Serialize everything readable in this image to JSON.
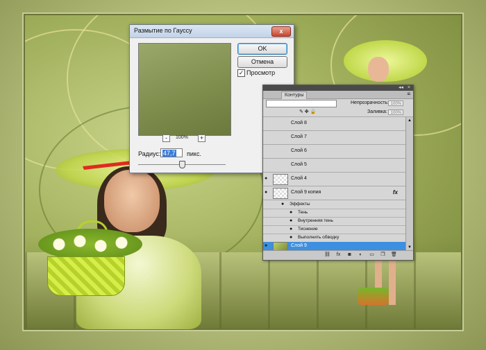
{
  "gauss_dialog": {
    "title": "Размытие по Гауссу",
    "close_glyph": "x",
    "ok_label": "OK",
    "cancel_label": "Отмена",
    "preview_checkbox": {
      "label": "Просмотр",
      "checked": true,
      "glyph": "✓"
    },
    "zoom": {
      "value": "100%",
      "minus": "-",
      "plus": "+"
    },
    "radius_label": "Радиус:",
    "radius_value": "47,7",
    "radius_unit": "пикс.",
    "slider_level": 0.5
  },
  "layers_panel": {
    "tabs": [
      "Контуры"
    ],
    "opacity_label": "Непрозрачность:",
    "opacity_value": "100%",
    "fill_label": "Заливка:",
    "fill_value": "100%",
    "layers": [
      {
        "name": "Слой 8",
        "visible": false
      },
      {
        "name": "Слой 7",
        "visible": false
      },
      {
        "name": "Слой 6",
        "visible": false
      },
      {
        "name": "Слой 5",
        "visible": false
      },
      {
        "name": "Слой 4",
        "visible": true
      },
      {
        "name": "Слой 9 копия",
        "visible": true,
        "fx": "fx"
      }
    ],
    "effects_header": "Эффекты",
    "effects": [
      "Тень",
      "Внутренняя тень",
      "Тиснение",
      "Выполнить обводку"
    ],
    "selected_layer": "Слой 9",
    "top_controls": {
      "collapse": "◂◂",
      "close": "×"
    },
    "menu_glyph": "≡",
    "eye_glyph": "●",
    "scroll_up": "▲",
    "scroll_down": "▼",
    "footer_icons": [
      "⛓",
      "fx",
      "◙",
      "◐",
      "▭",
      "❐",
      "🗑"
    ]
  },
  "colors": {
    "selection_blue": "#3d8fe0",
    "arrow_red": "#e02a20"
  }
}
